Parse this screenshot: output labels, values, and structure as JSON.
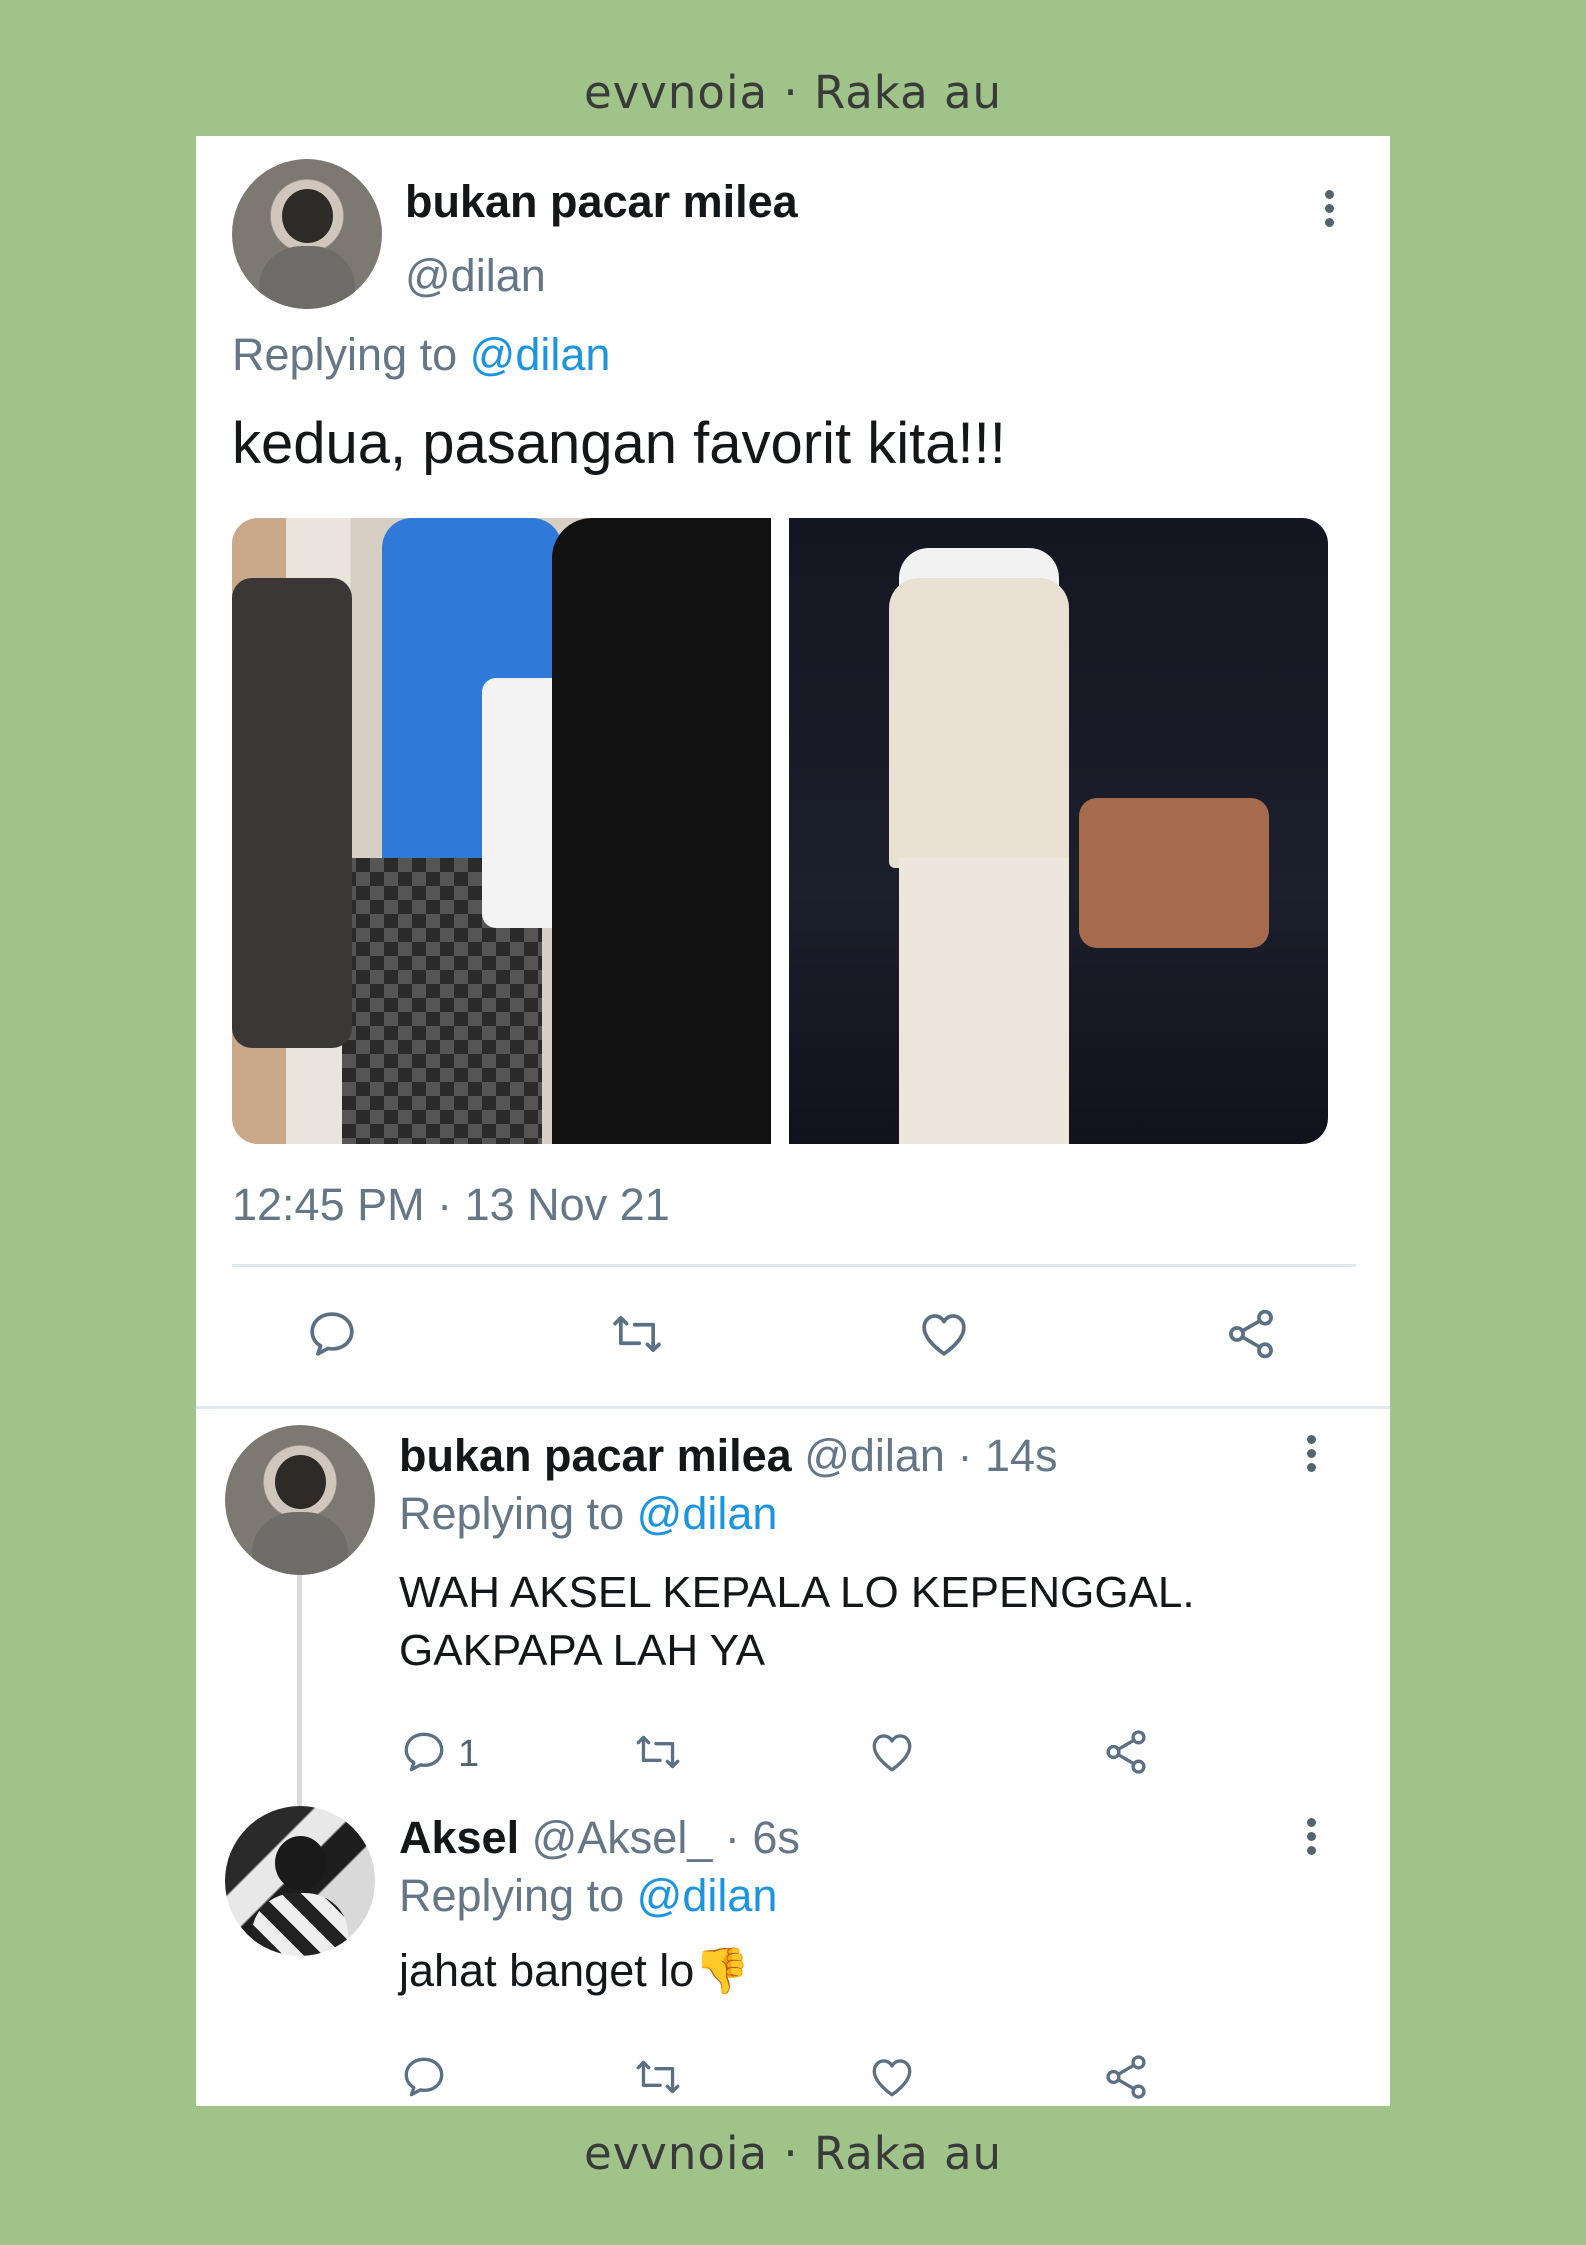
{
  "watermark_top": "evvnoia · Raka au",
  "watermark_bottom": "evvnoia · Raka au",
  "main_tweet": {
    "name": "bukan pacar milea",
    "handle": "@dilan",
    "replying_prefix": "Replying to",
    "replying_to": "@dilan",
    "text": "kedua, pasangan favorit kita!!!",
    "timestamp": "12:45 PM · 13 Nov 21"
  },
  "replies": [
    {
      "name": "bukan pacar milea",
      "meta": "@dilan · 14s",
      "replying_prefix": "Replying to",
      "replying_to": "@dilan",
      "text_line1": "WAH AKSEL KEPALA LO KEPENGGAL.",
      "text_line2": "GAKPAPA LAH YA",
      "reply_count": "1"
    },
    {
      "name": "Aksel",
      "meta": "@Aksel_ · 6s",
      "replying_prefix": "Replying to",
      "replying_to": "@dilan",
      "text": "jahat banget lo👎"
    }
  ],
  "icons": {
    "reply": "reply-icon",
    "retweet": "retweet-icon",
    "like": "heart-icon",
    "share": "share-icon",
    "more": "more-vertical-icon"
  },
  "colors": {
    "background": "#a0c38a",
    "link": "#1b95e0",
    "secondary_text": "#657786"
  }
}
